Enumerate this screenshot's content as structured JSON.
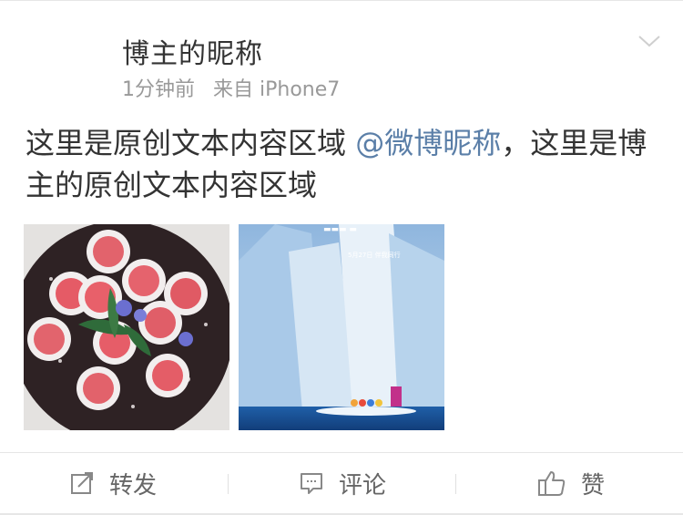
{
  "post": {
    "author": "博主的昵称",
    "time": "1分钟前",
    "source": "来自 iPhone7",
    "text_part1": "这里是原创文本内容区域 ",
    "mention": "@微博昵称",
    "text_part2": "，这里是博主的原创文本内容区域"
  },
  "poster": {
    "date": "5月27日 伴我同行"
  },
  "actions": {
    "repost": "转发",
    "comment": "评论",
    "like": "赞"
  },
  "icons": [
    "chevron-down-icon",
    "repost-icon",
    "comment-icon",
    "like-icon"
  ],
  "colors": {
    "mention": "#5b7fa8",
    "text": "#333333",
    "meta": "#999999",
    "divider": "#e6e6e6"
  }
}
